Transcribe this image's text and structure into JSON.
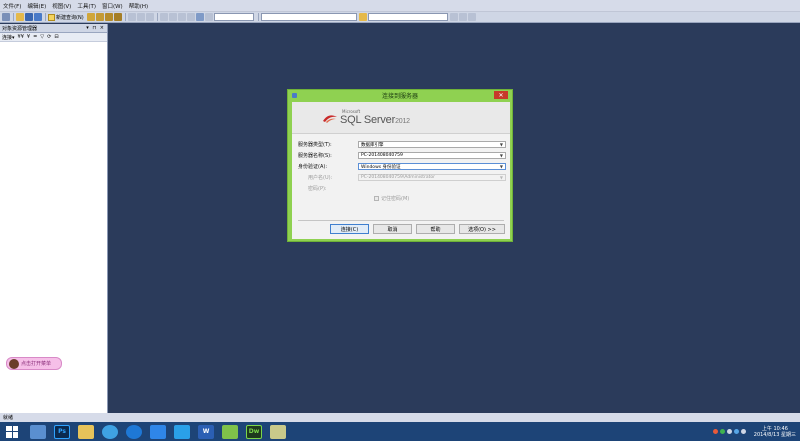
{
  "menubar": {
    "items": [
      "文件(F)",
      "编辑(E)",
      "视图(V)",
      "工具(T)",
      "窗口(W)",
      "帮助(H)"
    ]
  },
  "toolbar": {
    "new_query_label": "新建查询(N)"
  },
  "object_explorer": {
    "title": "对象资源管理器",
    "controls": "▾ ⊓ ×",
    "tools": [
      "连接▾",
      "¥¥",
      "¥",
      "=",
      "▽",
      "⟳",
      "⊟"
    ]
  },
  "mascot": {
    "text": "点击打开菜单"
  },
  "statusbar": {
    "text": "就绪"
  },
  "dialog": {
    "title": "连接到服务器",
    "close_label": "✕",
    "banner": {
      "brand_small": "Microsoft",
      "product": "SQL Server",
      "version": "2012"
    },
    "fields": {
      "server_type": {
        "label": "服务器类型(T):",
        "value": "数据库引擎"
      },
      "server_name": {
        "label": "服务器名称(S):",
        "value": "PC-201408040759"
      },
      "auth": {
        "label": "身份验证(A):",
        "value": "Windows 身份验证"
      },
      "username": {
        "label": "用户名(U):",
        "value": "PC-201408040759\\Administrator"
      },
      "password": {
        "label": "密码(P):",
        "value": ""
      }
    },
    "remember_password": "记住密码(M)",
    "buttons": {
      "connect": "连接(C)",
      "cancel": "取消",
      "help": "帮助",
      "options": "选项(O) >>"
    }
  },
  "taskbar": {
    "apps": [
      "file-explorer",
      "photoshop",
      "folder",
      "browser",
      "ie",
      "app-blue",
      "qq",
      "word",
      "settings",
      "dreamweaver",
      "tool"
    ],
    "ps_label": "Ps",
    "dw_label": "Dw",
    "word_label": "W",
    "clock_time": "上午 10:46",
    "clock_date": "2014/8/13 星期三"
  },
  "colors": {
    "desktop_bg": "#2b3b5b",
    "dialog_frame": "#8fd151",
    "taskbar": "#1d4477"
  }
}
